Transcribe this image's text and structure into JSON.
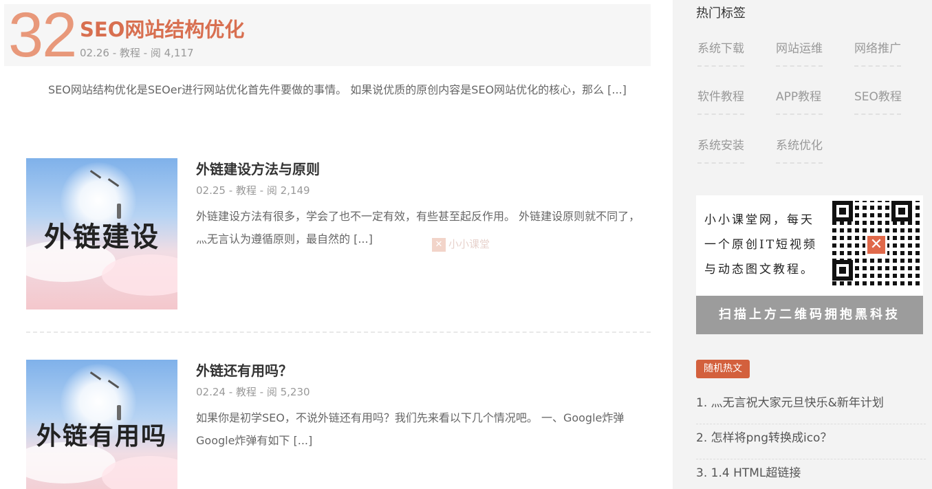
{
  "featured": {
    "number": "32",
    "title": "SEO网站结构优化",
    "meta": "02.26 - 教程 - 阅 4,117",
    "excerpt": "SEO网站结构优化是SEOer进行网站优化首先件要做的事情。 如果说优质的原创内容是SEO网站优化的核心，那么 [...]"
  },
  "posts": [
    {
      "thumb_text": "外链建设",
      "title": "外链建设方法与原则",
      "meta": "02.25 - 教程 - 阅 2,149",
      "excerpt": "外链建设方法有很多，学会了也不一定有效，有些甚至起反作用。 外链建设原则就不同了，灬无言认为遵循原则，最自然的 [...]"
    },
    {
      "thumb_text": "外链有用吗",
      "title": "外链还有用吗？",
      "meta": "02.24 - 教程 - 阅 5,230",
      "excerpt": "如果你是初学SEO，不说外链还有用吗？我们先来看以下几个情况吧。 一、Google炸弹 Google炸弹有如下 [...]"
    }
  ],
  "watermark": {
    "icon": "logo-x-icon",
    "text": "小小课堂"
  },
  "sidebar": {
    "tags_heading": "热门标签",
    "tags": [
      "系统下载",
      "网站运维",
      "网络推广",
      "软件教程",
      "APP教程",
      "SEO教程",
      "系统安装",
      "系统优化"
    ],
    "qr": {
      "lines": [
        "小小课堂网，每天",
        "一个原创IT短视频",
        "与动态图文教程。"
      ],
      "banner": "扫描上方二维码拥抱黑科技"
    },
    "random_badge": "随机热文",
    "random_posts": [
      "1. 灬无言祝大家元旦快乐&新年计划",
      "2. 怎样将png转换成ico？",
      "3. 1.4 HTML超链接"
    ]
  },
  "colors": {
    "accent": "#d86f50",
    "number": "#e8987a",
    "badge": "#d3603d",
    "sidebar_bg": "#f3f3f3"
  }
}
